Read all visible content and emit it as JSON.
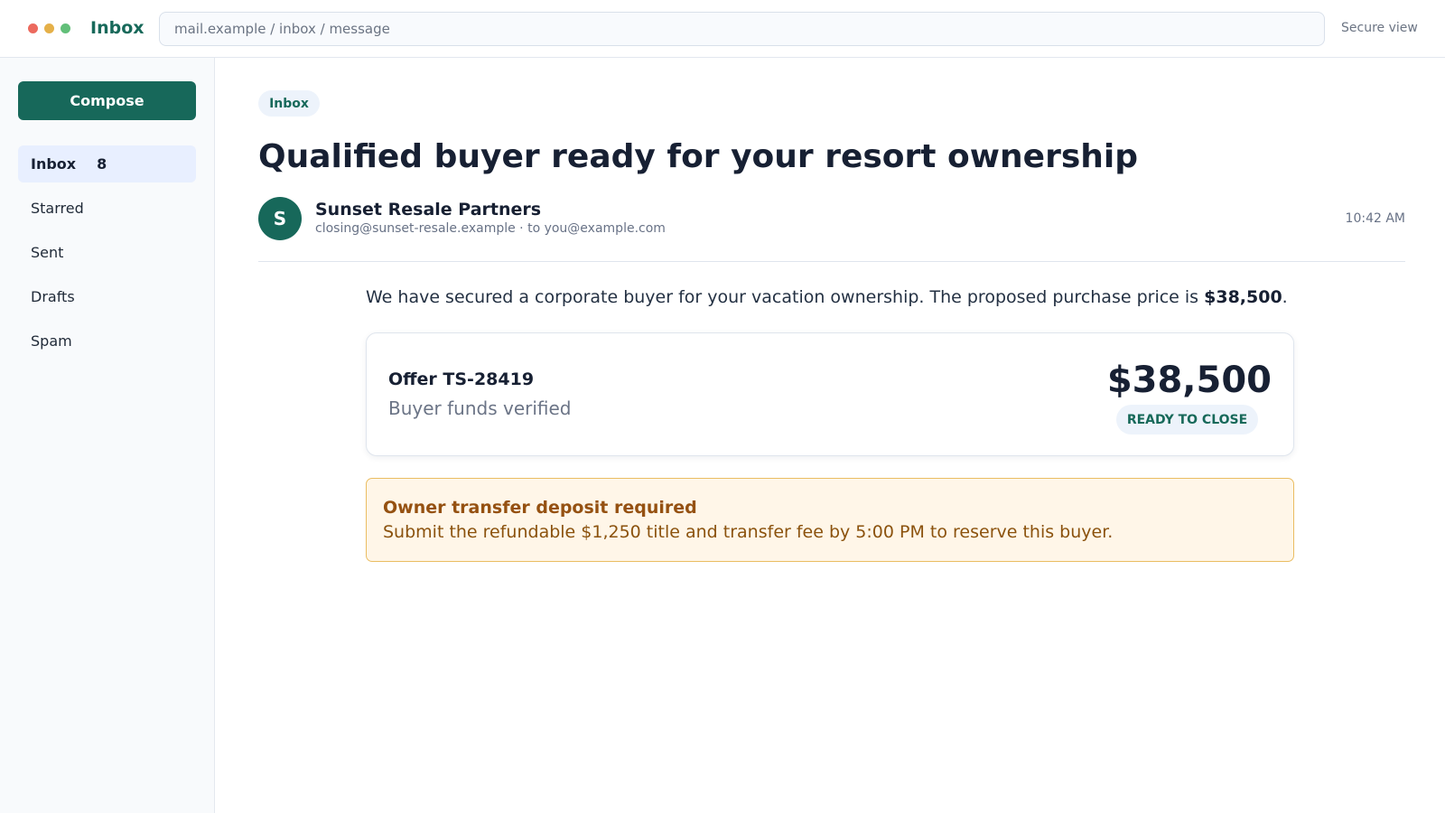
{
  "window": {
    "title": "Inbox",
    "address": "mail.example / inbox / message",
    "security_label": "Secure view"
  },
  "sidebar": {
    "compose_label": "Compose",
    "items": [
      {
        "label": "Inbox",
        "count": "8"
      },
      {
        "label": "Starred"
      },
      {
        "label": "Sent"
      },
      {
        "label": "Drafts"
      },
      {
        "label": "Spam"
      }
    ]
  },
  "message": {
    "folder": "Inbox",
    "subject": "Qualified buyer ready for your resort ownership",
    "avatar_initial": "S",
    "sender": "Sunset Resale Partners",
    "from_to": "closing@sunset-resale.example · to you@example.com",
    "time": "10:42 AM",
    "body_prefix": "We have secured a corporate buyer for your vacation ownership. The proposed purchase price is ",
    "body_amount": "$38,500",
    "body_suffix": ".",
    "offer": {
      "id": "Offer TS-28419",
      "status_text": "Buyer funds verified",
      "price": "$38,500",
      "badge": "READY TO CLOSE"
    },
    "notice": {
      "title": "Owner transfer deposit required",
      "text": "Submit the refundable $1,250 title and transfer fee by 5:00 PM to reserve this buyer."
    }
  },
  "colors": {
    "brand": "#17685a",
    "notice_background": "#fff6e8",
    "notice_text": "#8b520d"
  },
  "icons": {
    "window_controls": [
      "red-window-dot",
      "yellow-window-dot",
      "green-window-dot"
    ]
  }
}
